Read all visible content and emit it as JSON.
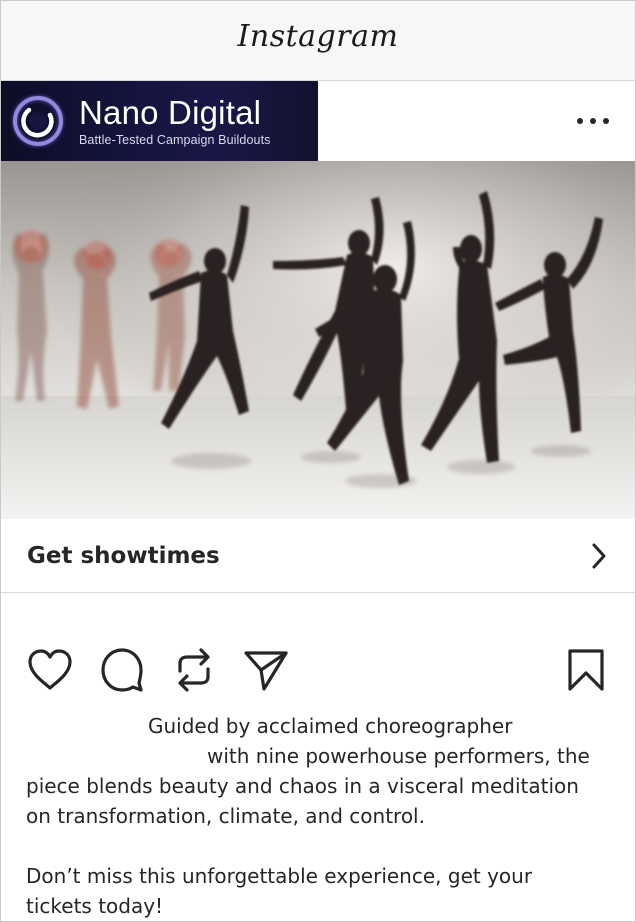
{
  "app": {
    "title": "Instagram"
  },
  "post": {
    "brand_name": "Nano Digital",
    "brand_tagline": "Battle-Tested Campaign Buildouts",
    "more_label": "…"
  },
  "cta": {
    "label": "Get showtimes"
  },
  "caption": {
    "line1": "Guided by acclaimed choreographer",
    "line2": "with nine powerhouse performers, the",
    "line3": "piece blends beauty and chaos in a visceral meditation",
    "line4": "on transformation, climate, and control.",
    "line5": "Don’t miss this unforgettable experience, get your",
    "line6": "tickets today!"
  },
  "icons": {
    "more": "more-options-icon",
    "like": "heart-icon",
    "comment": "comment-icon",
    "repost": "repost-icon",
    "share": "send-icon",
    "save": "bookmark-icon",
    "chevron": "chevron-right-icon"
  },
  "colors": {
    "text": "#262626",
    "divider": "#dbdbdb",
    "topbar_bg": "#f7f7f7",
    "brand_bg": "#151540",
    "brand_ring": "#8a7fd8"
  }
}
